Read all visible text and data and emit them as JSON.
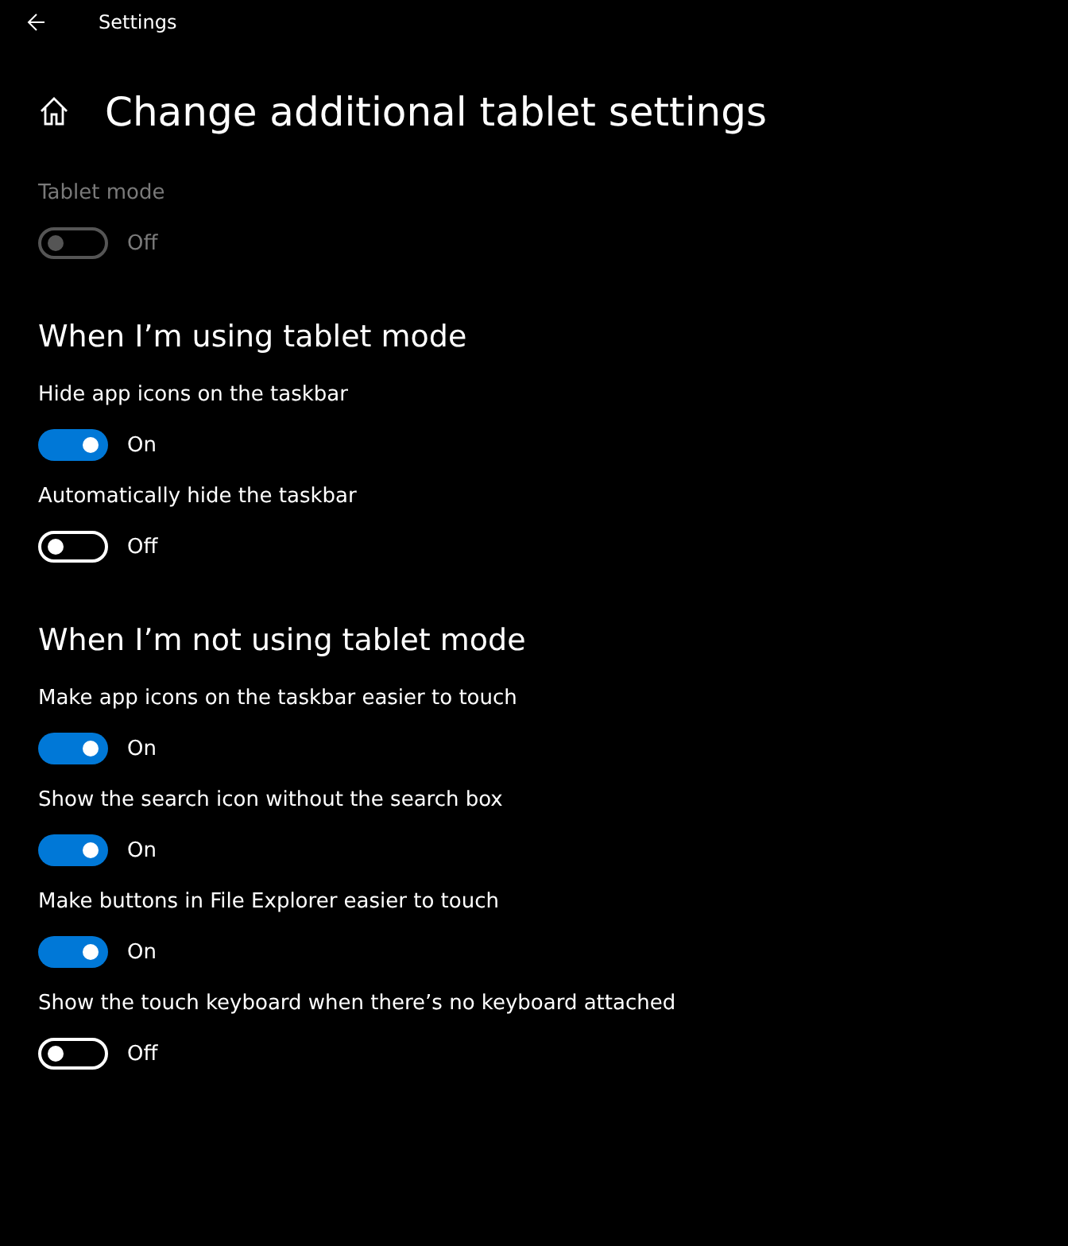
{
  "window": {
    "title": "Settings"
  },
  "page_title": "Change additional tablet settings",
  "top_settings": [
    {
      "label": "Tablet mode",
      "on": false,
      "state_text": "Off",
      "disabled": true
    }
  ],
  "sections": [
    {
      "heading": "When I’m using tablet mode",
      "settings": [
        {
          "label": "Hide app icons on the taskbar",
          "on": true,
          "state_text": "On",
          "disabled": false
        },
        {
          "label": "Automatically hide the taskbar",
          "on": false,
          "state_text": "Off",
          "disabled": false
        }
      ]
    },
    {
      "heading": "When I’m not using tablet mode",
      "settings": [
        {
          "label": "Make app icons on the taskbar easier to touch",
          "on": true,
          "state_text": "On",
          "disabled": false
        },
        {
          "label": "Show the search icon without the search box",
          "on": true,
          "state_text": "On",
          "disabled": false
        },
        {
          "label": "Make buttons in File Explorer easier to touch",
          "on": true,
          "state_text": "On",
          "disabled": false
        },
        {
          "label": "Show the touch keyboard when there’s no keyboard attached",
          "on": false,
          "state_text": "Off",
          "disabled": false
        }
      ]
    }
  ]
}
